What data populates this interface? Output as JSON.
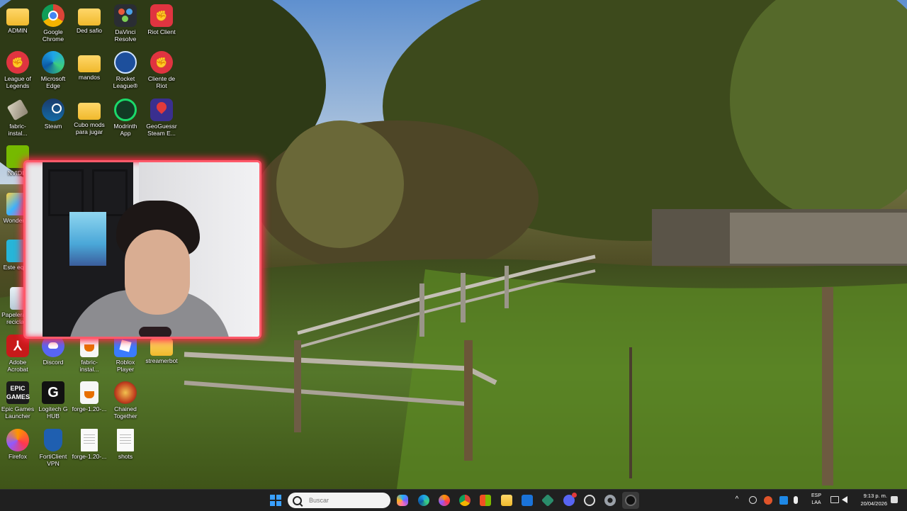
{
  "desktop": {
    "icons": [
      {
        "label": "ADMIN",
        "icon": "folder-icon"
      },
      {
        "label": "Google Chrome",
        "icon": "chrome-icon"
      },
      {
        "label": "Ded safio",
        "icon": "folder-icon"
      },
      {
        "label": "DaVinci Resolve",
        "icon": "davinci-icon"
      },
      {
        "label": "Riot Client",
        "icon": "riot-icon"
      },
      {
        "label": "League of Legends",
        "icon": "riot-icon"
      },
      {
        "label": "Microsoft Edge",
        "icon": "edge-icon"
      },
      {
        "label": "mandos",
        "icon": "folder-icon"
      },
      {
        "label": "Rocket League®",
        "icon": "rocket-league-icon"
      },
      {
        "label": "Cliente de Riot",
        "icon": "riot-icon"
      },
      {
        "label": "fabric-instal...",
        "icon": "installer-icon"
      },
      {
        "label": "Steam",
        "icon": "steam-icon"
      },
      {
        "label": "Cubo mods para jugar",
        "icon": "folder-icon"
      },
      {
        "label": "Modrinth App",
        "icon": "modrinth-icon"
      },
      {
        "label": "GeoGuessr Steam E...",
        "icon": "geoguessr-icon"
      },
      {
        "label": "NVIDIA",
        "icon": "nvidia-icon"
      },
      {
        "label": "Wonders...",
        "icon": "wondershare-icon"
      },
      {
        "label": "Este equ...",
        "icon": "this-pc-icon"
      },
      {
        "label": "Papelera de recicla...",
        "icon": "recycle-bin-icon"
      },
      {
        "label": "Adobe Acrobat",
        "icon": "acrobat-icon"
      },
      {
        "label": "Discord",
        "icon": "discord-icon"
      },
      {
        "label": "fabric-instal...",
        "icon": "java-icon"
      },
      {
        "label": "Roblox Player",
        "icon": "roblox-icon"
      },
      {
        "label": "streamerbot",
        "icon": "folder-icon"
      },
      {
        "label": "Epic Games Launcher",
        "icon": "epic-icon"
      },
      {
        "label": "Logitech G HUB",
        "icon": "logitech-icon"
      },
      {
        "label": "forge-1.20-...",
        "icon": "java-icon"
      },
      {
        "label": "Chained Together",
        "icon": "chained-together-icon"
      },
      {
        "label": "Firefox",
        "icon": "firefox-icon"
      },
      {
        "label": "FortiClient VPN",
        "icon": "forticlient-icon"
      },
      {
        "label": "forge-1.20-...",
        "icon": "document-icon"
      },
      {
        "label": "shots",
        "icon": "document-icon"
      }
    ]
  },
  "webcam": {
    "label": "webcam-overlay"
  },
  "taskbar": {
    "search_placeholder": "Buscar",
    "apps": [
      "start-icon",
      "copilot-icon",
      "edge-icon",
      "firefox-icon",
      "chrome-icon",
      "store-icon",
      "file-explorer-icon",
      "mail-icon",
      "vpn-icon",
      "discord-icon",
      "obs-icon",
      "settings-icon",
      "app-icon"
    ],
    "language_top": "ESP",
    "language_bottom": "LAA",
    "time": "9:13 p. m.",
    "date": "20/04/2026"
  },
  "colors": {
    "taskbar": "#202020",
    "webcam_border": "#ff5a6a",
    "folder": "#f0b92c"
  }
}
